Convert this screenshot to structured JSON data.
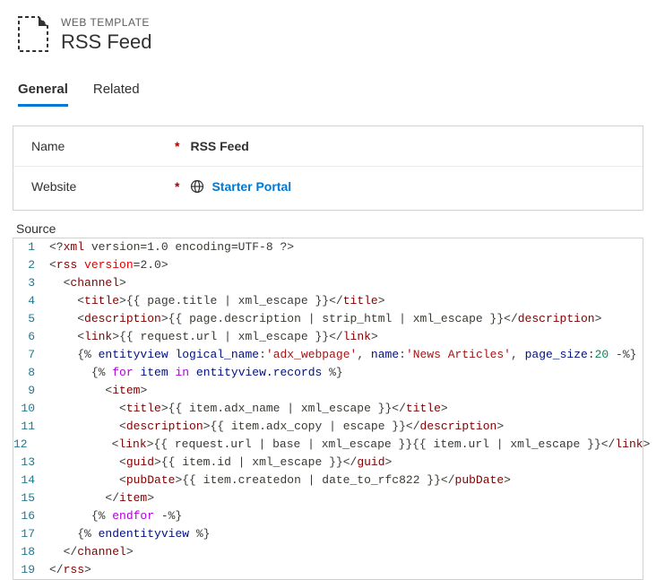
{
  "header": {
    "type_label": "WEB TEMPLATE",
    "title": "RSS Feed"
  },
  "tabs": {
    "general": "General",
    "related": "Related"
  },
  "form": {
    "name_label": "Name",
    "name_value": "RSS Feed",
    "website_label": "Website",
    "website_value": "Starter Portal"
  },
  "source": {
    "label": "Source",
    "lines": {
      "l1": {
        "t": "punct",
        "v": "<?"
      },
      "l1b": {
        "t": "decl",
        "v": "xml"
      },
      "l1c": {
        "t": "text",
        "v": " version=1.0 encoding=UTF-8 "
      },
      "l1d": {
        "t": "punct",
        "v": "?>"
      },
      "l2a": {
        "t": "bracket",
        "v": "<"
      },
      "l2b": {
        "t": "tag",
        "v": "rss"
      },
      "l2c": {
        "t": "text",
        "v": " "
      },
      "l2d": {
        "t": "attr",
        "v": "version"
      },
      "l2e": {
        "t": "text",
        "v": "=2.0"
      },
      "l2f": {
        "t": "bracket",
        "v": ">"
      },
      "l3a": {
        "t": "bracket",
        "v": "<"
      },
      "l3b": {
        "t": "tag",
        "v": "channel"
      },
      "l3c": {
        "t": "bracket",
        "v": ">"
      },
      "l4a": {
        "t": "bracket",
        "v": "<"
      },
      "l4b": {
        "t": "tag",
        "v": "title"
      },
      "l4c": {
        "t": "bracket",
        "v": ">"
      },
      "l4d": {
        "t": "text",
        "v": "{{ page.title | xml_escape }}"
      },
      "l4e": {
        "t": "bracket",
        "v": "</"
      },
      "l4f": {
        "t": "tag",
        "v": "title"
      },
      "l4g": {
        "t": "bracket",
        "v": ">"
      },
      "l5a": {
        "t": "bracket",
        "v": "<"
      },
      "l5b": {
        "t": "tag",
        "v": "description"
      },
      "l5c": {
        "t": "bracket",
        "v": ">"
      },
      "l5d": {
        "t": "text",
        "v": "{{ page.description | strip_html | xml_escape }}"
      },
      "l5e": {
        "t": "bracket",
        "v": "</"
      },
      "l5f": {
        "t": "tag",
        "v": "description"
      },
      "l5g": {
        "t": "bracket",
        "v": ">"
      },
      "l6a": {
        "t": "bracket",
        "v": "<"
      },
      "l6b": {
        "t": "tag",
        "v": "link"
      },
      "l6c": {
        "t": "bracket",
        "v": ">"
      },
      "l6d": {
        "t": "text",
        "v": "{{ request.url | xml_escape }}"
      },
      "l6e": {
        "t": "bracket",
        "v": "</"
      },
      "l6f": {
        "t": "tag",
        "v": "link"
      },
      "l6g": {
        "t": "bracket",
        "v": ">"
      },
      "l7a": {
        "t": "text",
        "v": "{% "
      },
      "l7b": {
        "t": "var",
        "v": "entityview"
      },
      "l7c": {
        "t": "text",
        "v": " "
      },
      "l7d": {
        "t": "var",
        "v": "logical_name"
      },
      "l7e": {
        "t": "text",
        "v": ":"
      },
      "l7f": {
        "t": "str",
        "v": "'adx_webpage'"
      },
      "l7g": {
        "t": "text",
        "v": ", "
      },
      "l7h": {
        "t": "var",
        "v": "name"
      },
      "l7i": {
        "t": "text",
        "v": ":"
      },
      "l7j": {
        "t": "str",
        "v": "'News Articles'"
      },
      "l7k": {
        "t": "text",
        "v": ", "
      },
      "l7l": {
        "t": "var",
        "v": "page_size"
      },
      "l7m": {
        "t": "text",
        "v": ":"
      },
      "l7n": {
        "t": "num",
        "v": "20"
      },
      "l7o": {
        "t": "text",
        "v": " -%}"
      },
      "l8a": {
        "t": "text",
        "v": "{% "
      },
      "l8b": {
        "t": "kw",
        "v": "for"
      },
      "l8c": {
        "t": "text",
        "v": " "
      },
      "l8d": {
        "t": "var",
        "v": "item"
      },
      "l8e": {
        "t": "text",
        "v": " "
      },
      "l8f": {
        "t": "kw",
        "v": "in"
      },
      "l8g": {
        "t": "text",
        "v": " "
      },
      "l8h": {
        "t": "var",
        "v": "entityview.records"
      },
      "l8i": {
        "t": "text",
        "v": " %}"
      },
      "l9a": {
        "t": "bracket",
        "v": "<"
      },
      "l9b": {
        "t": "tag",
        "v": "item"
      },
      "l9c": {
        "t": "bracket",
        "v": ">"
      },
      "l10a": {
        "t": "bracket",
        "v": "<"
      },
      "l10b": {
        "t": "tag",
        "v": "title"
      },
      "l10c": {
        "t": "bracket",
        "v": ">"
      },
      "l10d": {
        "t": "text",
        "v": "{{ item.adx_name | xml_escape }}"
      },
      "l10e": {
        "t": "bracket",
        "v": "</"
      },
      "l10f": {
        "t": "tag",
        "v": "title"
      },
      "l10g": {
        "t": "bracket",
        "v": ">"
      },
      "l11a": {
        "t": "bracket",
        "v": "<"
      },
      "l11b": {
        "t": "tag",
        "v": "description"
      },
      "l11c": {
        "t": "bracket",
        "v": ">"
      },
      "l11d": {
        "t": "text",
        "v": "{{ item.adx_copy | escape }}"
      },
      "l11e": {
        "t": "bracket",
        "v": "</"
      },
      "l11f": {
        "t": "tag",
        "v": "description"
      },
      "l11g": {
        "t": "bracket",
        "v": ">"
      },
      "l12a": {
        "t": "bracket",
        "v": "<"
      },
      "l12b": {
        "t": "tag",
        "v": "link"
      },
      "l12c": {
        "t": "bracket",
        "v": ">"
      },
      "l12d": {
        "t": "text",
        "v": "{{ request.url | base | xml_escape }}{{ item.url | xml_escape }}"
      },
      "l12e": {
        "t": "bracket",
        "v": "</"
      },
      "l12f": {
        "t": "tag",
        "v": "link"
      },
      "l12g": {
        "t": "bracket",
        "v": ">"
      },
      "l13a": {
        "t": "bracket",
        "v": "<"
      },
      "l13b": {
        "t": "tag",
        "v": "guid"
      },
      "l13c": {
        "t": "bracket",
        "v": ">"
      },
      "l13d": {
        "t": "text",
        "v": "{{ item.id | xml_escape }}"
      },
      "l13e": {
        "t": "bracket",
        "v": "</"
      },
      "l13f": {
        "t": "tag",
        "v": "guid"
      },
      "l13g": {
        "t": "bracket",
        "v": ">"
      },
      "l14a": {
        "t": "bracket",
        "v": "<"
      },
      "l14b": {
        "t": "tag",
        "v": "pubDate"
      },
      "l14c": {
        "t": "bracket",
        "v": ">"
      },
      "l14d": {
        "t": "text",
        "v": "{{ item.createdon | date_to_rfc822 }}"
      },
      "l14e": {
        "t": "bracket",
        "v": "</"
      },
      "l14f": {
        "t": "tag",
        "v": "pubDate"
      },
      "l14g": {
        "t": "bracket",
        "v": ">"
      },
      "l15a": {
        "t": "bracket",
        "v": "</"
      },
      "l15b": {
        "t": "tag",
        "v": "item"
      },
      "l15c": {
        "t": "bracket",
        "v": ">"
      },
      "l16a": {
        "t": "text",
        "v": "{% "
      },
      "l16b": {
        "t": "kw",
        "v": "endfor"
      },
      "l16c": {
        "t": "text",
        "v": " -%}"
      },
      "l17a": {
        "t": "text",
        "v": "{% "
      },
      "l17b": {
        "t": "var",
        "v": "endentityview"
      },
      "l17c": {
        "t": "text",
        "v": " %}"
      },
      "l18a": {
        "t": "bracket",
        "v": "</"
      },
      "l18b": {
        "t": "tag",
        "v": "channel"
      },
      "l18c": {
        "t": "bracket",
        "v": ">"
      },
      "l19a": {
        "t": "bracket",
        "v": "</"
      },
      "l19b": {
        "t": "tag",
        "v": "rss"
      },
      "l19c": {
        "t": "bracket",
        "v": ">"
      }
    },
    "line_numbers": {
      "1": "1",
      "2": "2",
      "3": "3",
      "4": "4",
      "5": "5",
      "6": "6",
      "7": "7",
      "8": "8",
      "9": "9",
      "10": "10",
      "11": "11",
      "12": "12",
      "13": "13",
      "14": "14",
      "15": "15",
      "16": "16",
      "17": "17",
      "18": "18",
      "19": "19"
    },
    "indent": {
      "i0": "",
      "i1": "  ",
      "i2": "    ",
      "i3": "      ",
      "i4": "        ",
      "i5": "          "
    }
  },
  "required_marker": "*"
}
